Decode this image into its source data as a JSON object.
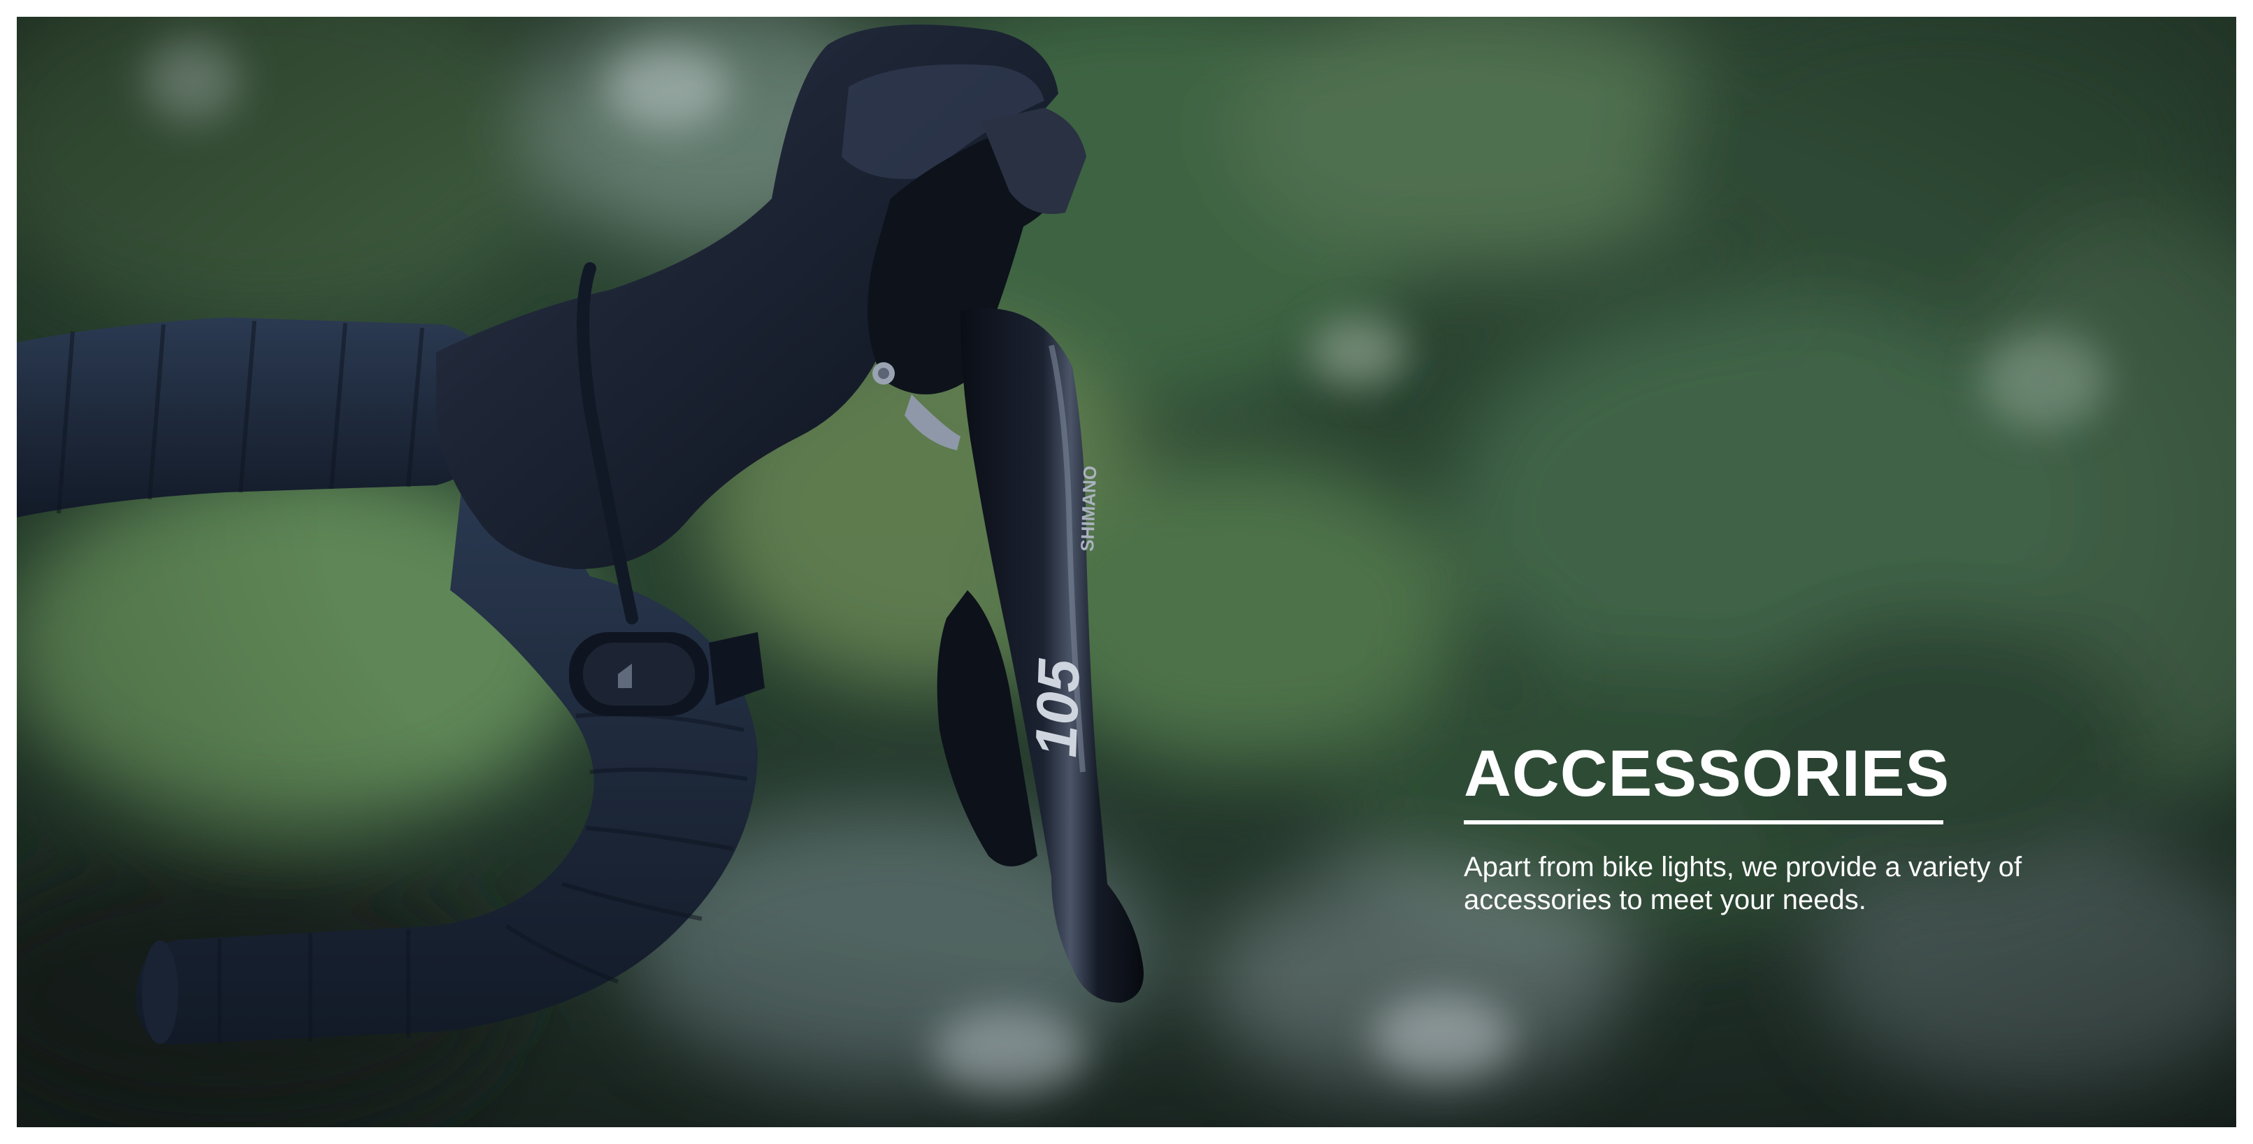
{
  "hero": {
    "heading": "ACCESSORIES",
    "description": "Apart from bike lights, we provide a variety of accessories to meet your needs."
  },
  "photo": {
    "subject": "road-bike-handlebar-with-shift-brake-lever",
    "lever_brand_mark": "105",
    "lever_maker_mark": "SHIMANO"
  },
  "colors": {
    "text": "#ffffff",
    "background_foliage": "#2f4a35",
    "handlebar_tape": "#1f2a3c"
  }
}
